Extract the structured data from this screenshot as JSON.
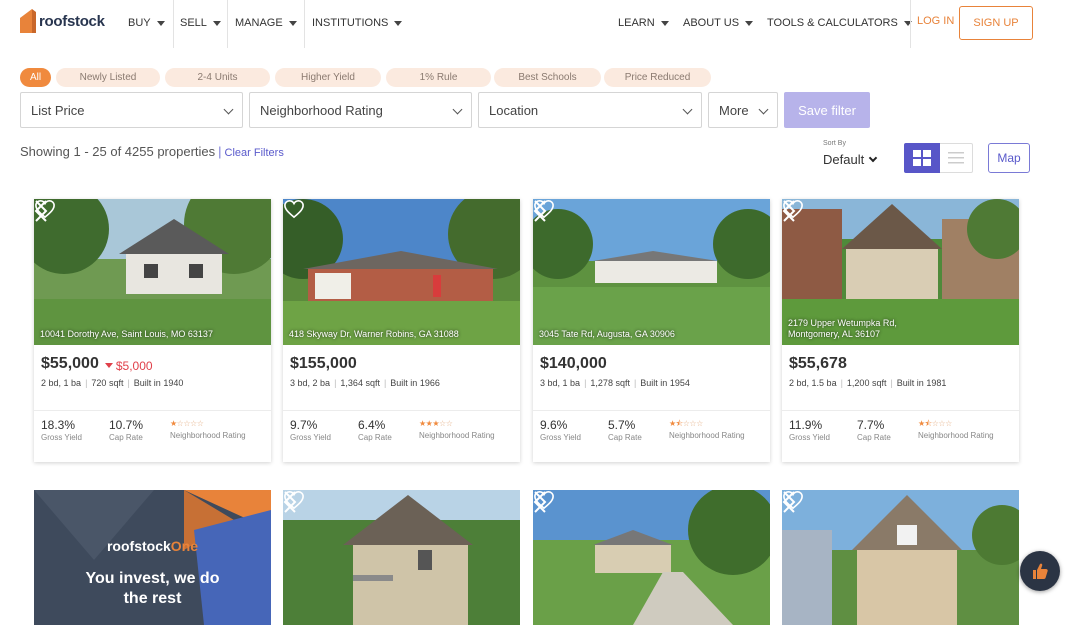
{
  "brand": {
    "name": "roofstock",
    "accent": "#e8833a",
    "primary": "#5856c8"
  },
  "nav": {
    "left": [
      {
        "label": "BUY"
      },
      {
        "label": "SELL"
      },
      {
        "label": "MANAGE"
      },
      {
        "label": "INSTITUTIONS"
      }
    ],
    "right": [
      {
        "label": "LEARN"
      },
      {
        "label": "ABOUT US"
      },
      {
        "label": "TOOLS & CALCULATORS"
      }
    ],
    "login": "LOG IN",
    "signup": "SIGN UP"
  },
  "chips": [
    "All",
    "Newly Listed",
    "2-4 Units",
    "Higher Yield",
    "1% Rule",
    "Best Schools",
    "Price Reduced"
  ],
  "filters": {
    "list_price": "List Price",
    "neighborhood_rating": "Neighborhood Rating",
    "location": "Location",
    "more": "More",
    "save_filter": "Save filter"
  },
  "results": {
    "showing": "Showing 1 - 25 of 4255 properties",
    "separator": "|",
    "clear_filters": "Clear Filters",
    "sort_by_label": "Sort By",
    "sort_value": "Default",
    "map_label": "Map"
  },
  "labels": {
    "gross_yield": "Gross Yield",
    "cap_rate": "Cap Rate",
    "neighborhood_rating": "Neighborhood Rating",
    "built_in": "Built in"
  },
  "listings": [
    {
      "address": "10041 Dorothy Ave, Saint Louis, MO 63137",
      "price": "$55,000",
      "price_drop": "$5,000",
      "beds": "2 bd",
      "baths": "1 ba",
      "sqft": "720 sqft",
      "built": "1940",
      "gross_yield": "18.3%",
      "cap_rate": "10.7%",
      "rating": 1
    },
    {
      "address": "418 Skyway Dr, Warner Robins, GA 31088",
      "price": "$155,000",
      "price_drop": "",
      "beds": "3 bd",
      "baths": "2 ba",
      "sqft": "1,364 sqft",
      "built": "1966",
      "gross_yield": "9.7%",
      "cap_rate": "6.4%",
      "rating": 3
    },
    {
      "address": "3045 Tate Rd, Augusta, GA 30906",
      "price": "$140,000",
      "price_drop": "",
      "beds": "3 bd",
      "baths": "1 ba",
      "sqft": "1,278 sqft",
      "built": "1954",
      "gross_yield": "9.6%",
      "cap_rate": "5.7%",
      "rating": 1.5
    },
    {
      "address_line1": "2179 Upper Wetumpka Rd,",
      "address_line2": "Montgomery, AL 36107",
      "price": "$55,678",
      "price_drop": "",
      "beds": "2 bd",
      "baths": "1.5 ba",
      "sqft": "1,200 sqft",
      "built": "1981",
      "gross_yield": "11.9%",
      "cap_rate": "7.7%",
      "rating": 1.5
    }
  ],
  "promo": {
    "brand_a": "roofstock",
    "brand_b": "One",
    "tagline_1": "You invest, we do",
    "tagline_2": "the rest"
  }
}
